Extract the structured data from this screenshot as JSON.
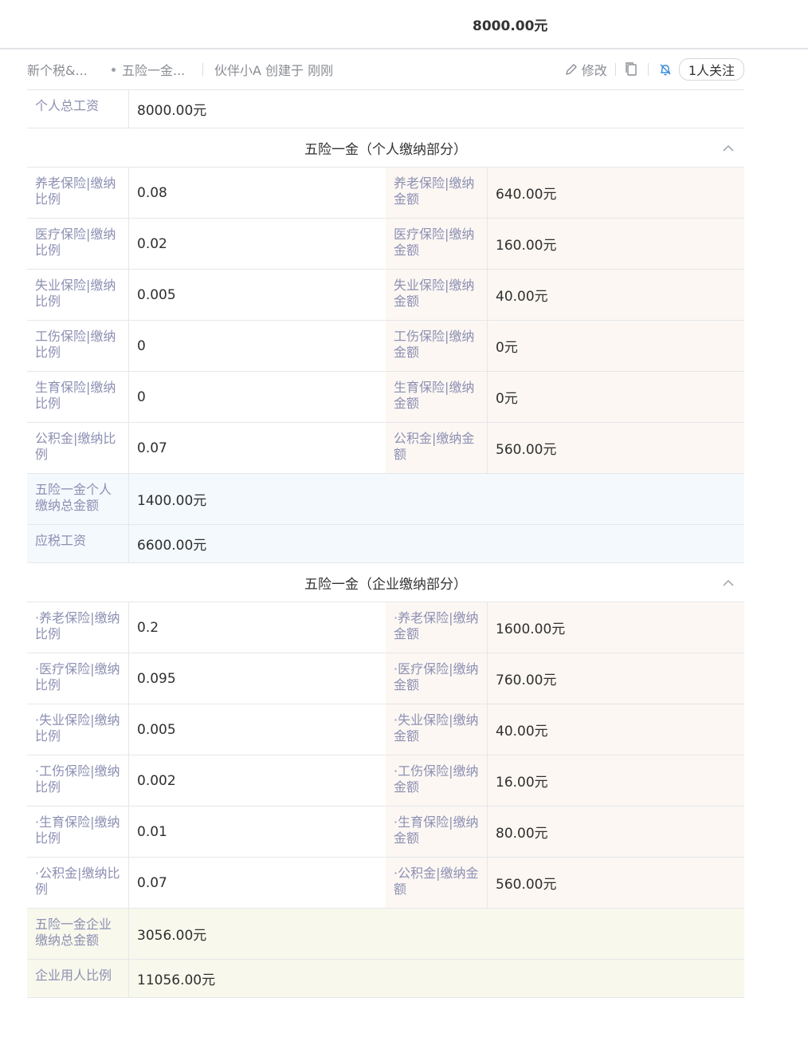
{
  "header": {
    "amount": "8000.00元"
  },
  "toolbar": {
    "crumb1": "新个税&...",
    "crumb2": "五险一金...",
    "meta": "伙伴小A 创建于 刚刚",
    "edit_label": "修改",
    "follow_label": "1人关注"
  },
  "total_salary": {
    "label": "个人总工资",
    "value": "8000.00元"
  },
  "personal_section": {
    "title": "五险一金（个人缴纳部分）",
    "rows": [
      {
        "l_label": "养老保险|缴纳比例",
        "l_value": "0.08",
        "r_label": "养老保险|缴纳金额",
        "r_value": "640.00元"
      },
      {
        "l_label": "医疗保险|缴纳比例",
        "l_value": "0.02",
        "r_label": "医疗保险|缴纳金额",
        "r_value": "160.00元"
      },
      {
        "l_label": "失业保险|缴纳比例",
        "l_value": "0.005",
        "r_label": "失业保险|缴纳金额",
        "r_value": "40.00元"
      },
      {
        "l_label": "工伤保险|缴纳比例",
        "l_value": "0",
        "r_label": "工伤保险|缴纳金额",
        "r_value": "0元"
      },
      {
        "l_label": "生育保险|缴纳比例",
        "l_value": "0",
        "r_label": "生育保险|缴纳金额",
        "r_value": "0元"
      },
      {
        "l_label": "公积金|缴纳比例",
        "l_value": "0.07",
        "r_label": "公积金|缴纳金额",
        "r_value": "560.00元"
      }
    ],
    "total": {
      "label": "五险一金个人缴纳总金额",
      "value": "1400.00元"
    },
    "taxable": {
      "label": "应税工资",
      "value": "6600.00元"
    }
  },
  "company_section": {
    "title": "五险一金（企业缴纳部分）",
    "rows": [
      {
        "l_label": "·养老保险|缴纳比例",
        "l_value": "0.2",
        "r_label": "·养老保险|缴纳金额",
        "r_value": "1600.00元"
      },
      {
        "l_label": "·医疗保险|缴纳比例",
        "l_value": "0.095",
        "r_label": "·医疗保险|缴纳金额",
        "r_value": "760.00元"
      },
      {
        "l_label": "·失业保险|缴纳比例",
        "l_value": "0.005",
        "r_label": "·失业保险|缴纳金额",
        "r_value": "40.00元"
      },
      {
        "l_label": "·工伤保险|缴纳比例",
        "l_value": "0.002",
        "r_label": "·工伤保险|缴纳金额",
        "r_value": "16.00元"
      },
      {
        "l_label": "·生育保险|缴纳比例",
        "l_value": "0.01",
        "r_label": "·生育保险|缴纳金额",
        "r_value": "80.00元"
      },
      {
        "l_label": "·公积金|缴纳比例",
        "l_value": "0.07",
        "r_label": "·公积金|缴纳金额",
        "r_value": "560.00元"
      }
    ],
    "total": {
      "label": "五险一金企业缴纳总金额",
      "value": "3056.00元"
    },
    "ratio": {
      "label": "企业用人比例",
      "value": "11056.00元"
    }
  }
}
